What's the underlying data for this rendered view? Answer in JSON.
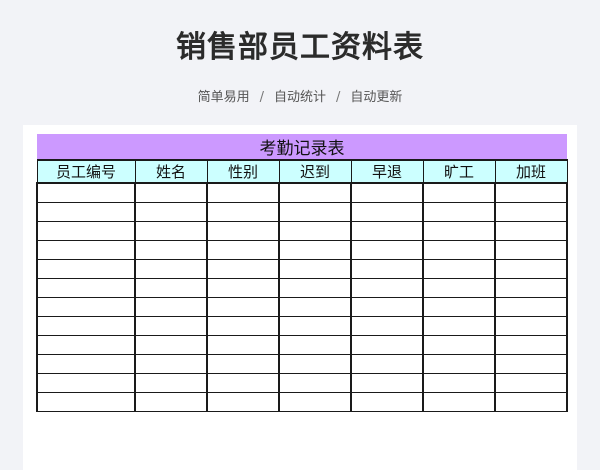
{
  "header": {
    "title": "销售部员工资料表",
    "subtitle": [
      "简单易用",
      "自动统计",
      "自动更新"
    ],
    "separator": "/"
  },
  "sheet": {
    "title": "考勤记录表",
    "columns": [
      "员工编号",
      "姓名",
      "性别",
      "迟到",
      "早退",
      "旷工",
      "加班"
    ],
    "empty_rows": 12,
    "colors": {
      "title_fill": "#cc99ff",
      "header_fill": "#ccffff",
      "border": "#1a1a1a"
    }
  }
}
